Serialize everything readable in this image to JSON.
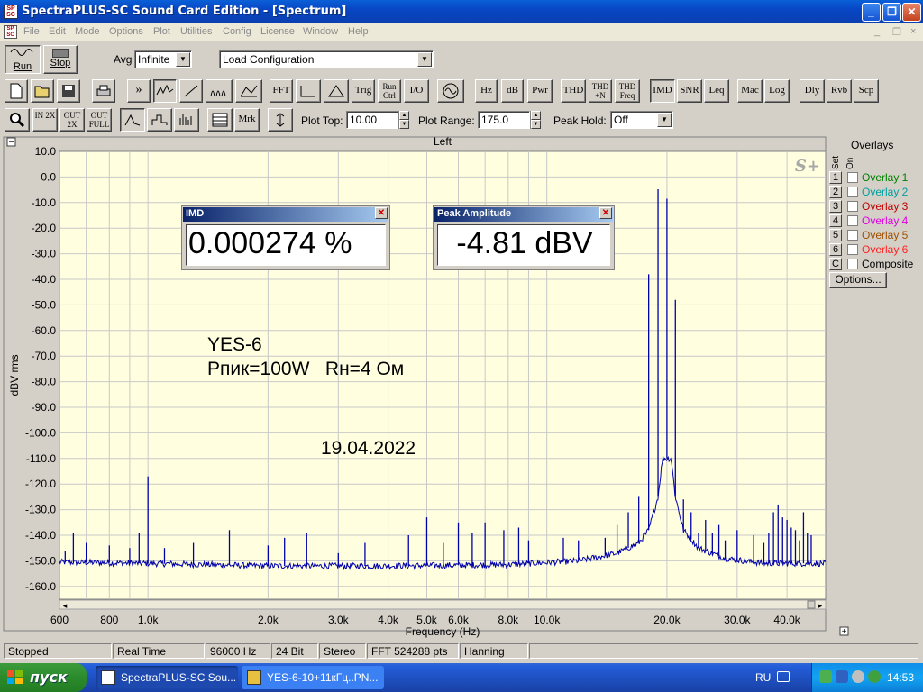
{
  "window": {
    "title": "SpectraPLUS-SC Sound Card Edition - [Spectrum]",
    "app_icon": "spectraplus-icon",
    "controls": [
      "_",
      "❐",
      "✕"
    ],
    "mdi_controls": [
      "_",
      "❐",
      "×"
    ]
  },
  "menu": [
    "File",
    "Edit",
    "Mode",
    "Options",
    "Plot",
    "Utilities",
    "Config",
    "License",
    "Window",
    "Help"
  ],
  "toolbar1": {
    "run_label": "Run",
    "stop_label": "Stop",
    "avg_label": "Avg",
    "avg_value": "Infinite",
    "config_value": "Load Configuration"
  },
  "toolbar2": {
    "buttons": [
      "FFT",
      "Trig",
      "Run Ctrl",
      "I/O",
      "Hz",
      "dB",
      "Pwr",
      "THD",
      "THD +N",
      "THD Freq",
      "IMD",
      "SNR",
      "Leq",
      "Mac",
      "Log",
      "Dly",
      "Rvb",
      "Scp"
    ]
  },
  "toolbar3": {
    "zoom_buttons": [
      "IN 2X",
      "OUT 2X",
      "OUT FULL"
    ],
    "mrk_label": "Mrk",
    "plot_top_label": "Plot Top:",
    "plot_top_value": "10.00",
    "plot_range_label": "Plot Range:",
    "plot_range_value": "175.0",
    "peak_hold_label": "Peak Hold:",
    "peak_hold_value": "Off"
  },
  "plot": {
    "channel_label": "Left",
    "logo": "S+",
    "colors": {
      "background": "#ffffe0",
      "trace": "#0000aa",
      "grid": "#c8c8c8"
    }
  },
  "chart_data": {
    "type": "line",
    "title": "Left",
    "xlabel": "Frequency (Hz)",
    "ylabel": "dBV rms",
    "xscale": "log",
    "xlim": [
      600,
      50000
    ],
    "ylim": [
      -165,
      10
    ],
    "x_ticks": [
      600,
      800,
      1000,
      2000,
      3000,
      4000,
      5000,
      6000,
      8000,
      10000,
      20000,
      30000,
      40000
    ],
    "x_tick_labels": [
      "600",
      "800",
      "1.0k",
      "2.0k",
      "3.0k",
      "4.0k",
      "5.0k",
      "6.0k",
      "8.0k",
      "10.0k",
      "20.0k",
      "30.0k",
      "40.0k"
    ],
    "y_ticks": [
      10,
      0,
      -10,
      -20,
      -30,
      -40,
      -50,
      -60,
      -70,
      -80,
      -90,
      -100,
      -110,
      -120,
      -130,
      -140,
      -150,
      -160
    ],
    "y_tick_labels": [
      "10.0",
      "0.0",
      "-10.0",
      "-20.0",
      "-30.0",
      "-40.0",
      "-50.0",
      "-60.0",
      "-70.0",
      "-80.0",
      "-90.0",
      "-100.0",
      "-110.0",
      "-120.0",
      "-130.0",
      "-140.0",
      "-150.0",
      "-160.0"
    ],
    "grid": true,
    "noise_floor": [
      {
        "x": 600,
        "y": -150.5
      },
      {
        "x": 1000,
        "y": -151
      },
      {
        "x": 2000,
        "y": -152
      },
      {
        "x": 4000,
        "y": -152
      },
      {
        "x": 8000,
        "y": -151.5
      },
      {
        "x": 12000,
        "y": -150
      },
      {
        "x": 15000,
        "y": -147
      },
      {
        "x": 17000,
        "y": -143
      },
      {
        "x": 18000,
        "y": -138
      },
      {
        "x": 19000,
        "y": -125
      },
      {
        "x": 19500,
        "y": -110
      },
      {
        "x": 20500,
        "y": -110
      },
      {
        "x": 21000,
        "y": -125
      },
      {
        "x": 22000,
        "y": -138
      },
      {
        "x": 24000,
        "y": -145
      },
      {
        "x": 28000,
        "y": -149
      },
      {
        "x": 35000,
        "y": -151
      },
      {
        "x": 48000,
        "y": -151
      }
    ],
    "peaks": [
      {
        "x": 19000,
        "y": -4.81
      },
      {
        "x": 20000,
        "y": -8.5
      },
      {
        "x": 18000,
        "y": -38
      },
      {
        "x": 21000,
        "y": -48
      },
      {
        "x": 1000,
        "y": -117
      },
      {
        "x": 17000,
        "y": -125
      },
      {
        "x": 22000,
        "y": -126
      },
      {
        "x": 16000,
        "y": -131
      },
      {
        "x": 23000,
        "y": -131
      },
      {
        "x": 39000,
        "y": -133
      },
      {
        "x": 40000,
        "y": -134
      },
      {
        "x": 38000,
        "y": -128
      },
      {
        "x": 37000,
        "y": -131
      },
      {
        "x": 36000,
        "y": -139
      },
      {
        "x": 41000,
        "y": -137
      },
      {
        "x": 42000,
        "y": -138
      },
      {
        "x": 44000,
        "y": -131
      },
      {
        "x": 45000,
        "y": -139
      },
      {
        "x": 46000,
        "y": -140
      },
      {
        "x": 43000,
        "y": -142
      },
      {
        "x": 35000,
        "y": -143
      },
      {
        "x": 33000,
        "y": -140
      },
      {
        "x": 30000,
        "y": -138
      },
      {
        "x": 28000,
        "y": -142
      },
      {
        "x": 27000,
        "y": -136
      },
      {
        "x": 26000,
        "y": -139
      },
      {
        "x": 25000,
        "y": -134
      },
      {
        "x": 24000,
        "y": -139
      },
      {
        "x": 15000,
        "y": -136
      },
      {
        "x": 14000,
        "y": -141
      },
      {
        "x": 12000,
        "y": -142
      },
      {
        "x": 11000,
        "y": -141
      },
      {
        "x": 9000,
        "y": -142
      },
      {
        "x": 8500,
        "y": -137
      },
      {
        "x": 7800,
        "y": -138
      },
      {
        "x": 7000,
        "y": -135
      },
      {
        "x": 6500,
        "y": -139
      },
      {
        "x": 6000,
        "y": -135
      },
      {
        "x": 5500,
        "y": -143
      },
      {
        "x": 5000,
        "y": -133
      },
      {
        "x": 4500,
        "y": -140
      },
      {
        "x": 3500,
        "y": -143
      },
      {
        "x": 3000,
        "y": -147
      },
      {
        "x": 2500,
        "y": -139
      },
      {
        "x": 2200,
        "y": -141
      },
      {
        "x": 2000,
        "y": -144
      },
      {
        "x": 1600,
        "y": -138
      },
      {
        "x": 1300,
        "y": -143
      },
      {
        "x": 1100,
        "y": -145
      },
      {
        "x": 950,
        "y": -139
      },
      {
        "x": 900,
        "y": -145
      },
      {
        "x": 800,
        "y": -144
      },
      {
        "x": 700,
        "y": -143
      },
      {
        "x": 650,
        "y": -139
      },
      {
        "x": 620,
        "y": -146
      }
    ]
  },
  "readouts": [
    {
      "title": "IMD",
      "value": "0.000274 %"
    },
    {
      "title": "Peak Amplitude",
      "value": "-4.81 dBV"
    }
  ],
  "annotations": [
    "YES-6",
    "Рпик=100W   Rн=4 Ом",
    "19.04.2022"
  ],
  "overlays": {
    "title": "Overlays",
    "set_label": "Set",
    "on_label": "On",
    "items": [
      {
        "set": "1",
        "name": "Overlay 1",
        "color": "#008000"
      },
      {
        "set": "2",
        "name": "Overlay 2",
        "color": "#00a0a0"
      },
      {
        "set": "3",
        "name": "Overlay 3",
        "color": "#c00000"
      },
      {
        "set": "4",
        "name": "Overlay 4",
        "color": "#e000e0"
      },
      {
        "set": "5",
        "name": "Overlay 5",
        "color": "#a05000"
      },
      {
        "set": "6",
        "name": "Overlay 6",
        "color": "#ff2020"
      },
      {
        "set": "C",
        "name": "Composite",
        "color": "#000000"
      }
    ],
    "options_label": "Options..."
  },
  "status": [
    "Stopped",
    "Real Time",
    "96000 Hz",
    "24 Bit",
    "Stereo",
    "FFT 524288 pts",
    "Hanning"
  ],
  "taskbar": {
    "start_label": "пуск",
    "tasks": [
      "SpectraPLUS-SC Sou...",
      "YES-6-10+11кГц..PN..."
    ],
    "lang": "RU",
    "clock": "14:53"
  }
}
